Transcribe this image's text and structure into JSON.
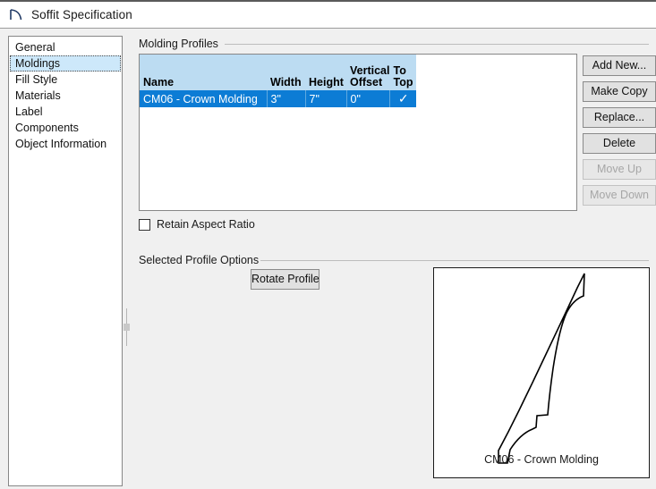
{
  "window": {
    "title": "Soffit Specification",
    "icon": "molding-profile-icon"
  },
  "sidebar": {
    "items": [
      {
        "label": "General",
        "selected": false
      },
      {
        "label": "Moldings",
        "selected": true
      },
      {
        "label": "Fill Style",
        "selected": false
      },
      {
        "label": "Materials",
        "selected": false
      },
      {
        "label": "Label",
        "selected": false
      },
      {
        "label": "Components",
        "selected": false
      },
      {
        "label": "Object Information",
        "selected": false
      }
    ]
  },
  "main": {
    "molding_profiles": {
      "group_label": "Molding Profiles",
      "columns": [
        "Name",
        "Width",
        "Height",
        "Vertical Offset",
        "To Top"
      ],
      "rows": [
        {
          "name": "CM06 - Crown Molding",
          "width": "3\"",
          "height": "7\"",
          "vertical_offset": "0\"",
          "to_top": "✓",
          "selected": true
        }
      ],
      "buttons": [
        {
          "label": "Add New...",
          "enabled": true
        },
        {
          "label": "Make Copy",
          "enabled": true
        },
        {
          "label": "Replace...",
          "enabled": true
        },
        {
          "label": "Delete",
          "enabled": true
        },
        {
          "label": "Move Up",
          "enabled": false
        },
        {
          "label": "Move Down",
          "enabled": false
        }
      ],
      "retain_aspect_ratio": {
        "label": "Retain Aspect Ratio",
        "checked": false
      }
    },
    "selected_profile_options": {
      "group_label": "Selected Profile Options",
      "rotate_button": "Rotate Profile",
      "preview_label": "CM06 - Crown Molding"
    }
  },
  "colors": {
    "window_background": "#f0f0f0",
    "titlebar_background": "#ffffff",
    "table_header": "#bcdcf2",
    "selection": "#0c7cd5",
    "selection_text": "#ffffff",
    "sidebar_selection": "#cde8fa",
    "button_face": "#e1e1e1",
    "disabled_text": "#a6a6a6",
    "icon": "#1f3864"
  }
}
